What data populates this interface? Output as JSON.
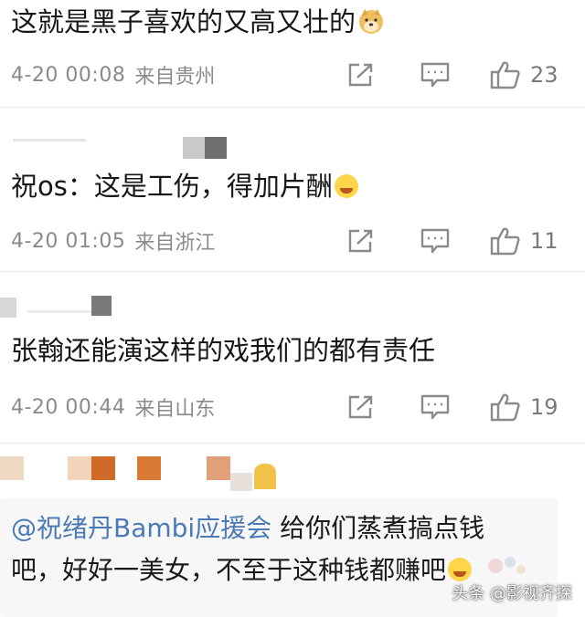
{
  "comments": [
    {
      "text": "这就是黑子喜欢的又高又壮的",
      "emoji": "doge-emoji",
      "time": "4-20 00:08",
      "location": "来自贵州",
      "likes": "23"
    },
    {
      "text": "祝os：这是工伤，得加片酬",
      "emoji": "laugh-cry-emoji",
      "time": "4-20 01:05",
      "location": "来自浙江",
      "likes": "11"
    },
    {
      "text": "张翰还能演这样的戏我们的都有责任",
      "time": "4-20 00:44",
      "location": "来自山东",
      "likes": "19"
    },
    {
      "mention": "@祝绪丹Bambi应援会",
      "text_line1": "给你们蒸煮搞点钱",
      "text_line2": "吧，好好一美女，不至于这种钱都赚吧",
      "emoji": "laugh-cry-emoji"
    }
  ],
  "icons": {
    "share": "share-icon",
    "reply": "comment-icon",
    "like": "thumbs-up-icon"
  },
  "watermark": "头条 @影视齐探",
  "colors": {
    "meta": "#8a8a8a",
    "mention": "#4a7ab5",
    "emoji": "#ffd54a"
  }
}
